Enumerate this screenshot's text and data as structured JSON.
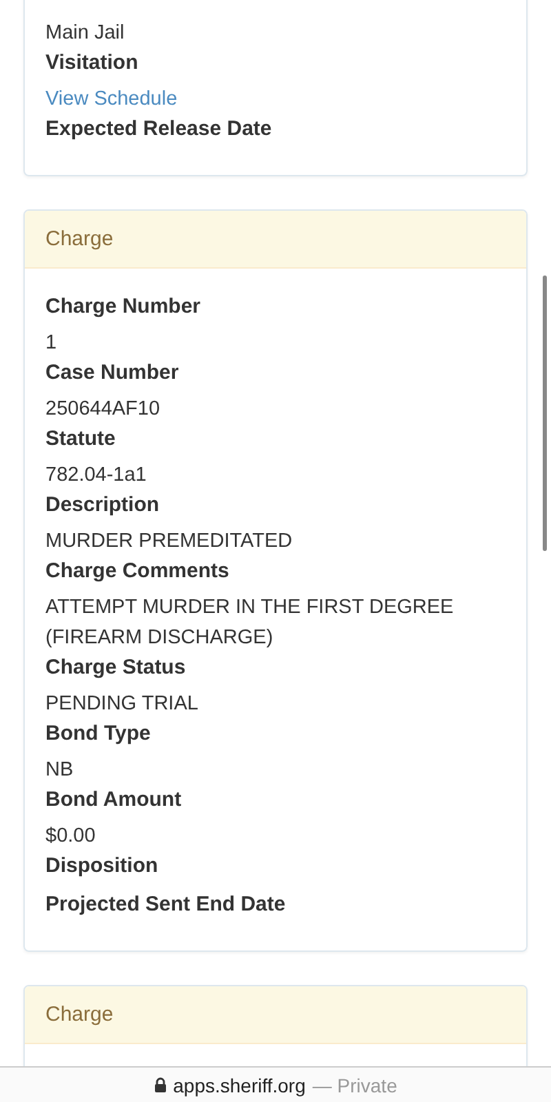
{
  "cards": [
    {
      "fields": [
        {
          "kind": "value",
          "text": "Main Jail"
        },
        {
          "kind": "label",
          "text": "Visitation"
        },
        {
          "kind": "link",
          "text": "View Schedule"
        },
        {
          "kind": "label",
          "text": "Expected Release Date"
        }
      ]
    },
    {
      "header": "Charge",
      "fields": [
        {
          "kind": "label",
          "text": "Charge Number"
        },
        {
          "kind": "value",
          "text": "1"
        },
        {
          "kind": "label",
          "text": "Case Number"
        },
        {
          "kind": "value",
          "text": "250644AF10"
        },
        {
          "kind": "label",
          "text": "Statute"
        },
        {
          "kind": "value",
          "text": "782.04-1a1"
        },
        {
          "kind": "label",
          "text": "Description"
        },
        {
          "kind": "value",
          "text": "MURDER PREMEDITATED"
        },
        {
          "kind": "label",
          "text": "Charge Comments"
        },
        {
          "kind": "value",
          "text": "ATTEMPT MURDER IN THE FIRST DEGREE (FIREARM DISCHARGE)"
        },
        {
          "kind": "label",
          "text": "Charge Status"
        },
        {
          "kind": "value",
          "text": "PENDING TRIAL"
        },
        {
          "kind": "label",
          "text": "Bond Type"
        },
        {
          "kind": "value",
          "text": "NB"
        },
        {
          "kind": "label",
          "text": "Bond Amount"
        },
        {
          "kind": "value",
          "text": "$0.00"
        },
        {
          "kind": "label",
          "text": "Disposition"
        },
        {
          "kind": "label",
          "text": "Projected Sent End Date"
        }
      ]
    },
    {
      "header": "Charge"
    }
  ],
  "browser_bar": {
    "url": "apps.sheriff.org",
    "mode": "— Private"
  }
}
